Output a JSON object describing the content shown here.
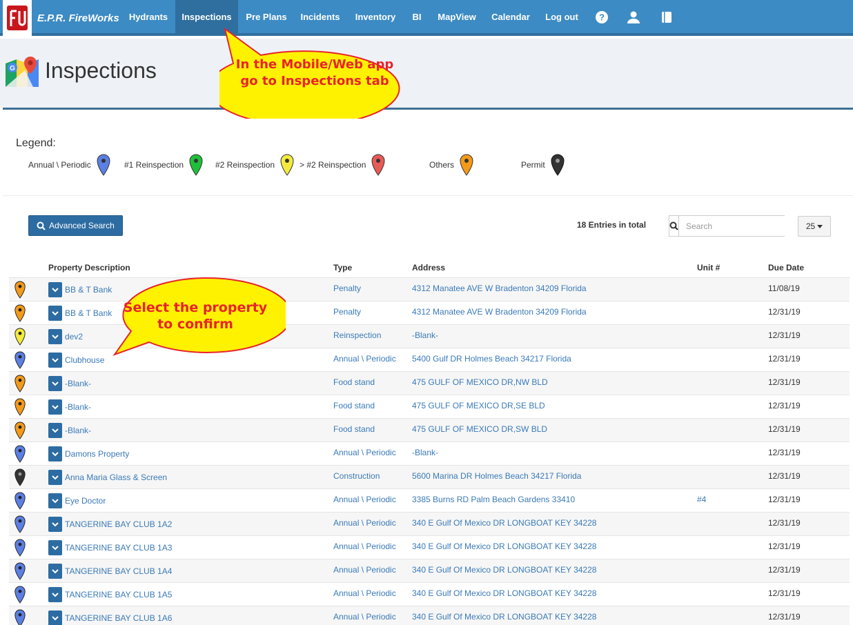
{
  "navbar": {
    "brand": "E.P.R. FireWorks",
    "items": [
      {
        "label": "Hydrants"
      },
      {
        "label": "Inspections"
      },
      {
        "label": "Pre Plans"
      },
      {
        "label": "Incidents"
      },
      {
        "label": "Inventory"
      },
      {
        "label": "BI"
      },
      {
        "label": "MapView"
      },
      {
        "label": "Calendar"
      },
      {
        "label": "Log out"
      }
    ],
    "icons": [
      "help-icon",
      "user-icon",
      "book-icon"
    ]
  },
  "page": {
    "title": "Inspections"
  },
  "legend": {
    "title": "Legend:",
    "items": [
      {
        "label": "Annual \\ Periodic",
        "color": "#5b7fe3"
      },
      {
        "label": "#1 Reinspection",
        "color": "#1fbf3a"
      },
      {
        "label": "#2 Reinspection",
        "color": "#f4ea3f"
      },
      {
        "label": "> #2 Reinspection",
        "color": "#e85a56"
      },
      {
        "label": "Others",
        "color": "#f39a1a"
      },
      {
        "label": "Permit",
        "color": "#333333"
      }
    ]
  },
  "toolbar": {
    "advanced_search": "Advanced Search",
    "entries": "18 Entries in total",
    "search_placeholder": "Search",
    "page_size": "25"
  },
  "table": {
    "headers": {
      "description": "Property Description",
      "type": "Type",
      "address": "Address",
      "unit": "Unit #",
      "due": "Due Date"
    },
    "rows": [
      {
        "pin": "#f39a1a",
        "description": "BB & T Bank",
        "type": "Penalty",
        "address": "4312 Manatee AVE W Bradenton 34209 Florida",
        "unit": "",
        "due": "11/08/19"
      },
      {
        "pin": "#f39a1a",
        "description": "BB & T Bank",
        "type": "Penalty",
        "address": "4312 Manatee AVE W Bradenton 34209 Florida",
        "unit": "",
        "due": "12/31/19"
      },
      {
        "pin": "#f4ea3f",
        "description": "dev2",
        "type": "Reinspection",
        "address": "-Blank-",
        "unit": "",
        "due": "12/31/19"
      },
      {
        "pin": "#5b7fe3",
        "description": "Clubhouse",
        "type": "Annual \\ Periodic",
        "address": "5400 Gulf DR Holmes Beach 34217 Florida",
        "unit": "",
        "due": "12/31/19"
      },
      {
        "pin": "#f39a1a",
        "description": "-Blank-",
        "type": "Food stand",
        "address": "475 GULF OF MEXICO DR,NW BLD",
        "unit": "",
        "due": "12/31/19"
      },
      {
        "pin": "#f39a1a",
        "description": "-Blank-",
        "type": "Food stand",
        "address": "475 GULF OF MEXICO DR,SE BLD",
        "unit": "",
        "due": "12/31/19"
      },
      {
        "pin": "#f39a1a",
        "description": "-Blank-",
        "type": "Food stand",
        "address": "475 GULF OF MEXICO DR,SW BLD",
        "unit": "",
        "due": "12/31/19"
      },
      {
        "pin": "#5b7fe3",
        "description": "Damons Property",
        "type": "Annual \\ Periodic",
        "address": "-Blank-",
        "unit": "",
        "due": "12/31/19"
      },
      {
        "pin": "#333333",
        "description": "Anna Maria Glass & Screen",
        "type": "Construction",
        "address": "5600 Marina DR Holmes Beach 34217 Florida",
        "unit": "",
        "due": "12/31/19"
      },
      {
        "pin": "#5b7fe3",
        "description": "Eye Doctor",
        "type": "Annual \\ Periodic",
        "address": "3385 Burns RD Palm Beach Gardens 33410",
        "unit": "#4",
        "due": "12/31/19"
      },
      {
        "pin": "#5b7fe3",
        "description": "TANGERINE BAY CLUB 1A2",
        "type": "Annual \\ Periodic",
        "address": "340 E Gulf Of Mexico DR LONGBOAT KEY 34228",
        "unit": "",
        "due": "12/31/19"
      },
      {
        "pin": "#5b7fe3",
        "description": "TANGERINE BAY CLUB 1A3",
        "type": "Annual \\ Periodic",
        "address": "340 E Gulf Of Mexico DR LONGBOAT KEY 34228",
        "unit": "",
        "due": "12/31/19"
      },
      {
        "pin": "#5b7fe3",
        "description": "TANGERINE BAY CLUB 1A4",
        "type": "Annual \\ Periodic",
        "address": "340 E Gulf Of Mexico DR LONGBOAT KEY 34228",
        "unit": "",
        "due": "12/31/19"
      },
      {
        "pin": "#5b7fe3",
        "description": "TANGERINE BAY CLUB 1A5",
        "type": "Annual \\ Periodic",
        "address": "340 E Gulf Of Mexico DR LONGBOAT KEY 34228",
        "unit": "",
        "due": "12/31/19"
      },
      {
        "pin": "#5b7fe3",
        "description": "TANGERINE BAY CLUB 1A6",
        "type": "Annual \\ Periodic",
        "address": "340 E Gulf Of Mexico DR LONGBOAT KEY 34228",
        "unit": "",
        "due": "12/31/19"
      }
    ]
  },
  "callouts": {
    "top": [
      "In the Mobile/Web app",
      "go to Inspections tab"
    ],
    "middle": [
      "Select the property",
      "to confirm"
    ]
  }
}
